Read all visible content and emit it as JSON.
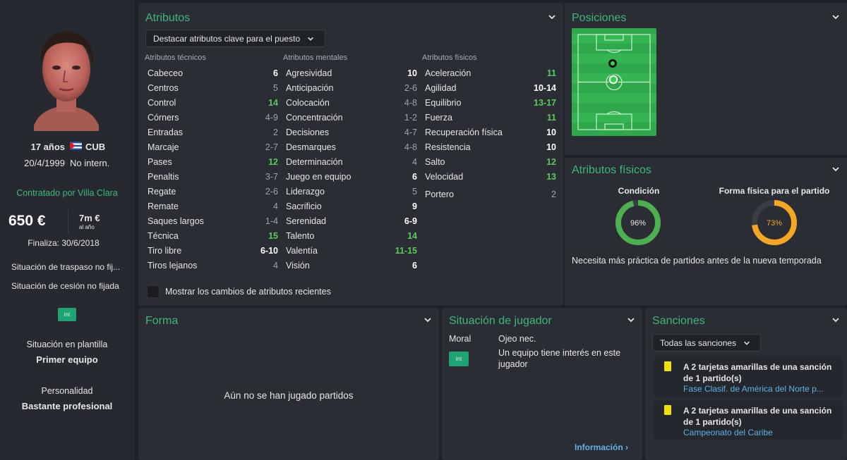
{
  "profile": {
    "age": "17 años",
    "nation": "CUB",
    "dob": "20/4/1999",
    "intl": "No intern.",
    "contracted_by": "Contratado por Villa Clara",
    "wage": "650 €",
    "value": "7m €",
    "value_unit": "al año",
    "contract_end": "Finaliza: 30/6/2018",
    "transfer_status": "Situación de traspaso no fij...",
    "loan_status": "Situación de cesión no fijada",
    "badge": "int",
    "squad_label": "Situación en plantilla",
    "squad_value": "Primer equipo",
    "personality_label": "Personalidad",
    "personality_value": "Bastante profesional"
  },
  "attributes": {
    "title": "Atributos",
    "dropdown": "Destacar atributos clave para el puesto",
    "technical_header": "Atributos técnicos",
    "mental_header": "Atributos mentales",
    "physical_header": "Atributos físicos",
    "technical": [
      {
        "name": "Cabeceo",
        "value": "6",
        "tone": "white"
      },
      {
        "name": "Centros",
        "value": "5",
        "tone": "grey"
      },
      {
        "name": "Control",
        "value": "14",
        "tone": "green"
      },
      {
        "name": "Córners",
        "value": "4-9",
        "tone": "grey"
      },
      {
        "name": "Entradas",
        "value": "2",
        "tone": "grey"
      },
      {
        "name": "Marcaje",
        "value": "2-7",
        "tone": "grey"
      },
      {
        "name": "Pases",
        "value": "12",
        "tone": "green"
      },
      {
        "name": "Penaltis",
        "value": "3-7",
        "tone": "grey"
      },
      {
        "name": "Regate",
        "value": "2-6",
        "tone": "grey"
      },
      {
        "name": "Remate",
        "value": "4",
        "tone": "grey"
      },
      {
        "name": "Saques largos",
        "value": "1-4",
        "tone": "grey"
      },
      {
        "name": "Técnica",
        "value": "15",
        "tone": "green"
      },
      {
        "name": "Tiro libre",
        "value": "6-10",
        "tone": "white"
      },
      {
        "name": "Tiros lejanos",
        "value": "4",
        "tone": "grey"
      }
    ],
    "mental": [
      {
        "name": "Agresividad",
        "value": "10",
        "tone": "white"
      },
      {
        "name": "Anticipación",
        "value": "2-6",
        "tone": "grey"
      },
      {
        "name": "Colocación",
        "value": "4-8",
        "tone": "grey"
      },
      {
        "name": "Concentración",
        "value": "1-2",
        "tone": "grey"
      },
      {
        "name": "Decisiones",
        "value": "4-7",
        "tone": "grey"
      },
      {
        "name": "Desmarques",
        "value": "4-8",
        "tone": "grey"
      },
      {
        "name": "Determinación",
        "value": "4",
        "tone": "grey"
      },
      {
        "name": "Juego en equipo",
        "value": "6",
        "tone": "white"
      },
      {
        "name": "Liderazgo",
        "value": "5",
        "tone": "grey"
      },
      {
        "name": "Sacrificio",
        "value": "9",
        "tone": "white"
      },
      {
        "name": "Serenidad",
        "value": "6-9",
        "tone": "white"
      },
      {
        "name": "Talento",
        "value": "14",
        "tone": "green"
      },
      {
        "name": "Valentía",
        "value": "11-15",
        "tone": "green"
      },
      {
        "name": "Visión",
        "value": "6",
        "tone": "white"
      }
    ],
    "physical": [
      {
        "name": "Aceleración",
        "value": "11",
        "tone": "green"
      },
      {
        "name": "Agilidad",
        "value": "10-14",
        "tone": "white"
      },
      {
        "name": "Equilibrio",
        "value": "13-17",
        "tone": "green"
      },
      {
        "name": "Fuerza",
        "value": "11",
        "tone": "green"
      },
      {
        "name": "Recuperación física",
        "value": "10",
        "tone": "white"
      },
      {
        "name": "Resistencia",
        "value": "10",
        "tone": "white"
      },
      {
        "name": "Salto",
        "value": "12",
        "tone": "green"
      },
      {
        "name": "Velocidad",
        "value": "13",
        "tone": "green"
      }
    ],
    "goalkeeper": {
      "name": "Portero",
      "value": "2",
      "tone": "grey"
    },
    "show_changes": "Mostrar los cambios de atributos recientes"
  },
  "positions": {
    "title": "Posiciones"
  },
  "physical_panel": {
    "title": "Atributos físicos",
    "condition_label": "Condición",
    "condition_value": "96%",
    "condition_fraction": 0.96,
    "condition_color": "#4caf50",
    "match_fitness_label": "Forma física para el partido",
    "match_fitness_value": "73%",
    "match_fitness_fraction": 0.73,
    "match_fitness_color": "#f5a623",
    "note": "Necesita más práctica de partidos antes de la nueva temporada"
  },
  "form": {
    "title": "Forma",
    "empty": "Aún no se han jugado partidos"
  },
  "player_status": {
    "title": "Situación de jugador",
    "moral_label": "Moral",
    "badge": "int",
    "scout_label": "Ojeo nec.",
    "interest": "Un equipo tiene interés en este jugador",
    "info_link": "Información"
  },
  "sanctions": {
    "title": "Sanciones",
    "dropdown": "Todas las sanciones",
    "items": [
      {
        "text": "A 2 tarjetas amarillas de una sanción de 1 partido(s)",
        "competition": "Fase Clasif. de América del Norte p..."
      },
      {
        "text": "A 2 tarjetas amarillas de una sanción de 1 partido(s)",
        "competition": "Campeonato del Caribe"
      }
    ]
  },
  "colors": {
    "accent": "#3fb77a",
    "green_value": "#5cc95c",
    "panel": "#2a2d34",
    "background": "#1e2127"
  }
}
